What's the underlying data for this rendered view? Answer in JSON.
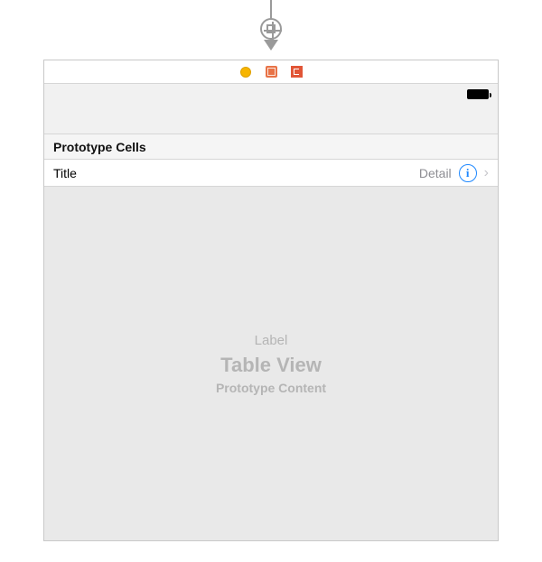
{
  "arrow": {
    "kind": "segue-arrow"
  },
  "scene_toolbar": {
    "icons": [
      "view-controller-icon",
      "first-responder-icon",
      "exit-icon"
    ]
  },
  "status_bar": {
    "battery_state": "full"
  },
  "section_header": "Prototype Cells",
  "prototype_cell": {
    "title": "Title",
    "detail": "Detail",
    "info_glyph": "i",
    "disclosure_glyph": "›"
  },
  "placeholder": {
    "label": "Label",
    "main": "Table View",
    "sub": "Prototype Content"
  }
}
